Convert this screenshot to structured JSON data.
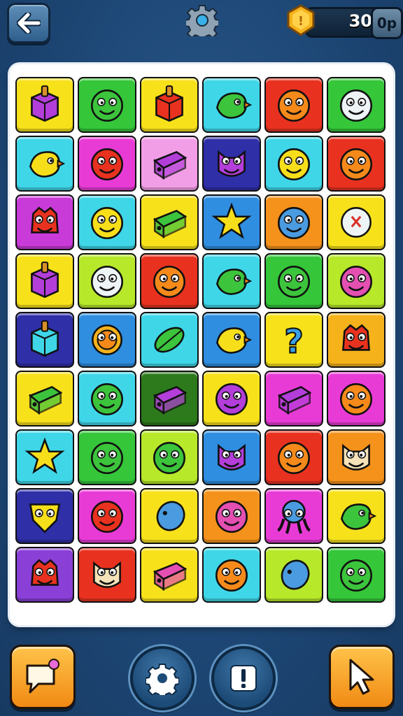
{
  "header": {
    "back_icon": "arrow-left-icon",
    "settings_icon": "gear-icon",
    "coin_icon": "gold-coin-icon",
    "coin_value": "30",
    "coin_unit": "0p"
  },
  "colors": {
    "background": "#1d4674",
    "board": "#ffffff",
    "accent_orange": "#f5a623"
  },
  "board": {
    "rows": 9,
    "columns": 6,
    "tiles": [
      [
        {
          "color": "#f7e11b",
          "icon": "purple-box-icon"
        },
        {
          "color": "#35c63a",
          "icon": "green-blob-icon"
        },
        {
          "color": "#f7e11b",
          "icon": "red-box-icon"
        },
        {
          "color": "#3fd6e8",
          "icon": "green-bird-icon"
        },
        {
          "color": "#e8321f",
          "icon": "orange-blob-icon"
        },
        {
          "color": "#35c63a",
          "icon": "white-blob-icon"
        }
      ],
      [
        {
          "color": "#3fd6e8",
          "icon": "yellow-bird-icon"
        },
        {
          "color": "#e83bd6",
          "icon": "red-balloon-icon"
        },
        {
          "color": "#f29ee6",
          "icon": "purple-cube-icon"
        },
        {
          "color": "#2f2fa8",
          "icon": "purple-cat-icon"
        },
        {
          "color": "#3fd6e8",
          "icon": "yellow-blob-icon"
        },
        {
          "color": "#e8321f",
          "icon": "orange-blob-icon"
        }
      ],
      [
        {
          "color": "#c93bd9",
          "icon": "red-monster-icon"
        },
        {
          "color": "#3fd6e8",
          "icon": "yellow-blob-icon"
        },
        {
          "color": "#f7e11b",
          "icon": "green-pencil-icon"
        },
        {
          "color": "#2f8ee0",
          "icon": "yellow-star-icon"
        },
        {
          "color": "#f5921b",
          "icon": "blue-blob-icon"
        },
        {
          "color": "#f7e11b",
          "icon": "white-ghost-icon"
        }
      ],
      [
        {
          "color": "#f7e11b",
          "icon": "purple-box-icon"
        },
        {
          "color": "#b8e82a",
          "icon": "white-blob-icon"
        },
        {
          "color": "#e8321f",
          "icon": "orange-blob-icon"
        },
        {
          "color": "#3fd6e8",
          "icon": "green-bird-icon"
        },
        {
          "color": "#35c63a",
          "icon": "green-blob-icon"
        },
        {
          "color": "#b8e82a",
          "icon": "pink-blob-icon"
        }
      ],
      [
        {
          "color": "#2f2fa8",
          "icon": "cyan-box-icon"
        },
        {
          "color": "#2f8ee0",
          "icon": "orange-sun-icon"
        },
        {
          "color": "#3fd6e8",
          "icon": "green-leaf-icon"
        },
        {
          "color": "#2f8ee0",
          "icon": "yellow-chick-icon"
        },
        {
          "color": "#f7e11b",
          "icon": "question-mark-icon"
        },
        {
          "color": "#f5b21b",
          "icon": "red-monster-icon"
        }
      ],
      [
        {
          "color": "#f7e11b",
          "icon": "green-pencil-icon"
        },
        {
          "color": "#3fd6e8",
          "icon": "green-blob-icon"
        },
        {
          "color": "#2d7a1c",
          "icon": "purple-cube-icon"
        },
        {
          "color": "#f7e11b",
          "icon": "purple-blob-icon"
        },
        {
          "color": "#e83bd6",
          "icon": "purple-pencil-icon"
        },
        {
          "color": "#e83bd6",
          "icon": "orange-blob-icon"
        }
      ],
      [
        {
          "color": "#3fd6e8",
          "icon": "yellow-star-icon"
        },
        {
          "color": "#35c63a",
          "icon": "green-blob-icon"
        },
        {
          "color": "#b8e82a",
          "icon": "green-blob-icon"
        },
        {
          "color": "#2f8ee0",
          "icon": "purple-cat-icon"
        },
        {
          "color": "#e8321f",
          "icon": "orange-blob-icon"
        },
        {
          "color": "#f5921b",
          "icon": "cream-cat-icon"
        }
      ],
      [
        {
          "color": "#2f2fa8",
          "icon": "yellow-shield-icon"
        },
        {
          "color": "#e83bd6",
          "icon": "red-blob-icon"
        },
        {
          "color": "#f7e11b",
          "icon": "blue-fish-icon"
        },
        {
          "color": "#f5921b",
          "icon": "pink-blob-icon"
        },
        {
          "color": "#e83bd6",
          "icon": "blue-octopus-icon"
        },
        {
          "color": "#f7e11b",
          "icon": "green-bird-icon"
        }
      ],
      [
        {
          "color": "#8a3fd6",
          "icon": "red-monster-icon"
        },
        {
          "color": "#e8321f",
          "icon": "cream-cat-icon"
        },
        {
          "color": "#f7e11b",
          "icon": "pink-cube-icon"
        },
        {
          "color": "#3fd6e8",
          "icon": "orange-blob-icon"
        },
        {
          "color": "#b8e82a",
          "icon": "blue-fish-icon"
        },
        {
          "color": "#35c63a",
          "icon": "green-blob-icon"
        }
      ]
    ]
  },
  "footer": {
    "chat_icon": "speech-bubble-icon",
    "settings_icon": "gear-icon",
    "alert_icon": "exclamation-icon",
    "pointer_icon": "cursor-arrow-icon"
  }
}
